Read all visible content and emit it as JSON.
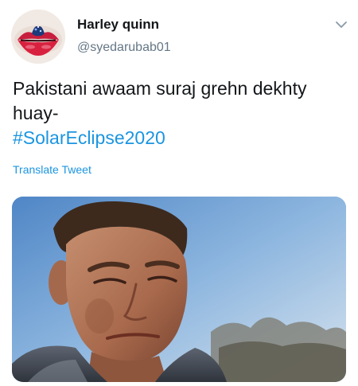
{
  "tweet": {
    "author": {
      "display_name": "Harley quinn",
      "handle": "@syedarubab01",
      "avatar_icon": "lips-avatar"
    },
    "menu_icon": "chevron-down-icon",
    "text_line1": "Pakistani awaam suraj grehn dekhty",
    "text_line2": "huay-",
    "hashtag": "#SolarEclipse2020",
    "translate_label": "Translate Tweet",
    "media": {
      "type": "photo",
      "description_icon": "man-squinting-at-sun-photo"
    },
    "colors": {
      "text": "#14171a",
      "secondary": "#657786",
      "link": "#1b95e0"
    }
  }
}
